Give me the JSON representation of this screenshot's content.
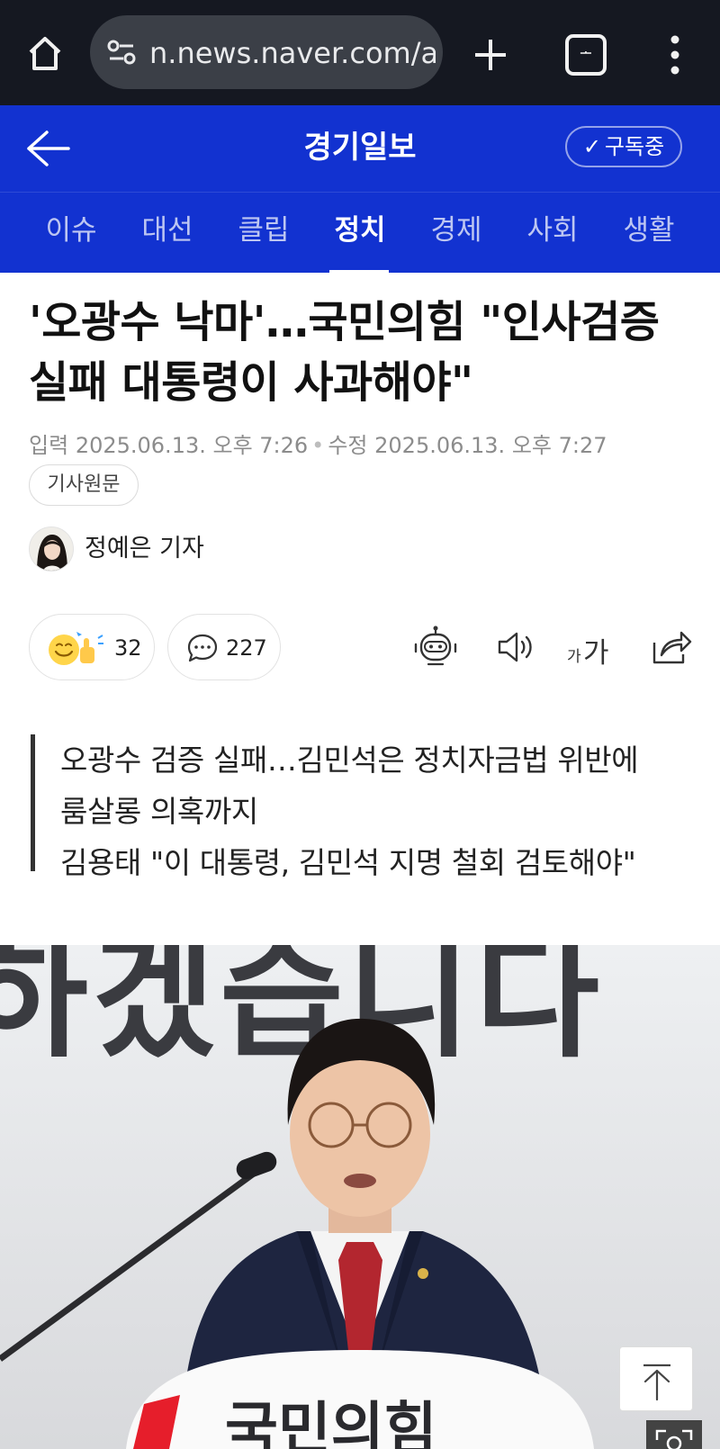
{
  "browser": {
    "url": "n.news.naver.com/a",
    "tab_count": "ᅩ"
  },
  "header": {
    "publisher": "경기일보",
    "subscribe_label": "구독중"
  },
  "nav": {
    "items": [
      "이슈",
      "대선",
      "클립",
      "정치",
      "경제",
      "사회",
      "생활"
    ],
    "active": "정치"
  },
  "article": {
    "headline": "'오광수 낙마'…국민의힘 \"인사검증 실패 대통령이 사과해야\"",
    "input_label": "입력",
    "input_date": "2025.06.13. 오후 7:26",
    "modified_label": "수정",
    "modified_date": "2025.06.13. 오후 7:27",
    "original_label": "기사원문",
    "reporter": "정예은 기자",
    "reaction_count": "32",
    "comment_count": "227",
    "font_small": "가",
    "font_big": "가",
    "summary": [
      "오광수 검증 실패…김민석은 정치자금법 위반에",
      "룸살롱 의혹까지",
      "김용태 \"이 대통령, 김민석 지명 철회 검토해야\""
    ]
  },
  "photo": {
    "backdrop_text": "하겠습니다",
    "podium_text": "국민의힘"
  },
  "colors": {
    "brand": "#1232d0",
    "browser_bar": "#151821",
    "party_red": "#e61e2b"
  }
}
